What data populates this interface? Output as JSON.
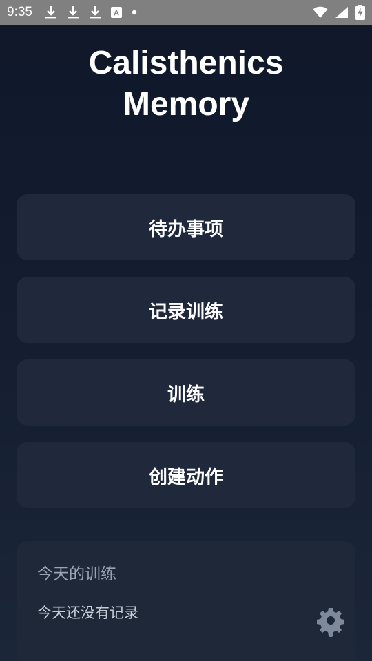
{
  "status_bar": {
    "time": "9:35",
    "notification_icons": [
      "download-icon",
      "download-icon",
      "download-icon",
      "font-app-icon",
      "dot-icon"
    ],
    "a_glyph": "A",
    "system_icons": [
      "wifi-icon",
      "signal-icon",
      "battery-charging-icon"
    ]
  },
  "app": {
    "title_line1": "Calisthenics",
    "title_line2": "Memory"
  },
  "menu": {
    "todo_label": "待办事项",
    "log_training_label": "记录训练",
    "training_label": "训练",
    "create_exercise_label": "创建动作"
  },
  "today": {
    "title": "今天的训练",
    "empty_message": "今天还没有记录"
  },
  "settings": {
    "icon": "gear-icon"
  },
  "colors": {
    "background": "#0f1729",
    "card": "#1f293b",
    "status_bar": "#808080",
    "text_primary": "#ffffff",
    "text_secondary": "#9aa3b2"
  }
}
